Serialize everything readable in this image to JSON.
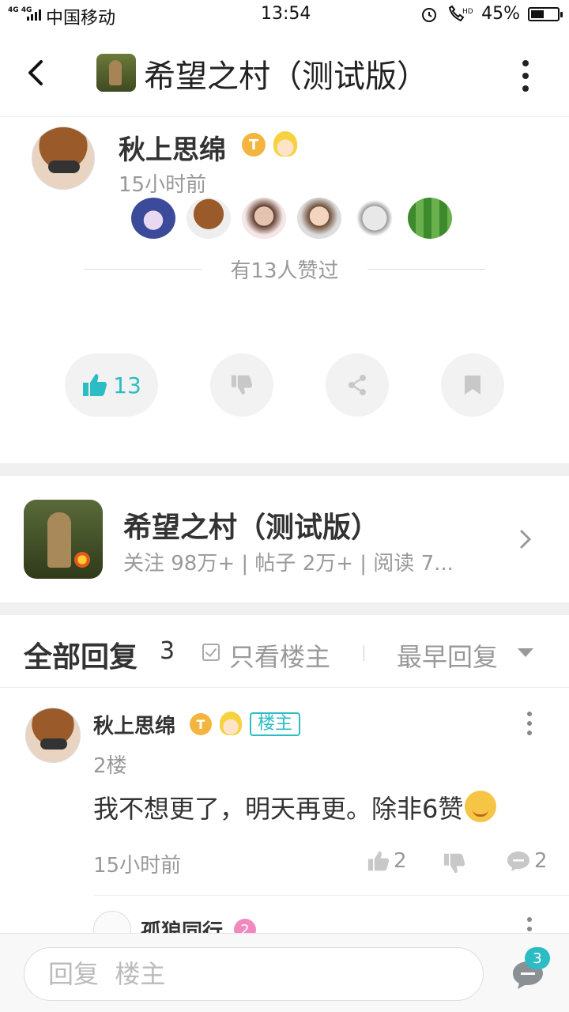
{
  "status_bar": {
    "network": "4G 4G",
    "carrier": "中国移动",
    "time": "13:54",
    "battery": "45%",
    "icons": [
      "alarm-icon",
      "hd-call-icon",
      "battery-icon"
    ]
  },
  "header": {
    "title": "希望之村（测试版）",
    "back_icon": "back-chevron-icon",
    "more_icon": "more-vertical-icon"
  },
  "post": {
    "author": "秋上思绵",
    "badge_t": "T",
    "time": "15小时前",
    "likers_count_text": "有13人赞过",
    "actions": {
      "like_count": "13"
    }
  },
  "forum": {
    "name": "希望之村（测试版）",
    "stats": "关注 98万+ | 帖子 2万+ | 阅读 7..."
  },
  "replies": {
    "title": "全部回复",
    "count": "3",
    "only_owner": "只看楼主",
    "sort": "最早回复",
    "items": [
      {
        "author": "秋上思绵",
        "badge_t": "T",
        "owner_tag": "楼主",
        "floor": "2楼",
        "content": "我不想更了，明天再更。除非6赞",
        "time": "15小时前",
        "likes": "2",
        "comments": "2"
      }
    ],
    "sub_reply": {
      "author": "孤狼同行",
      "badge": "2"
    }
  },
  "bottom_bar": {
    "placeholder": "回复  楼主",
    "badge": "3"
  },
  "colors": {
    "accent": "#2bbcc4",
    "badge_gold": "#f4b53f",
    "text_primary": "#333333",
    "text_secondary": "#999999"
  }
}
